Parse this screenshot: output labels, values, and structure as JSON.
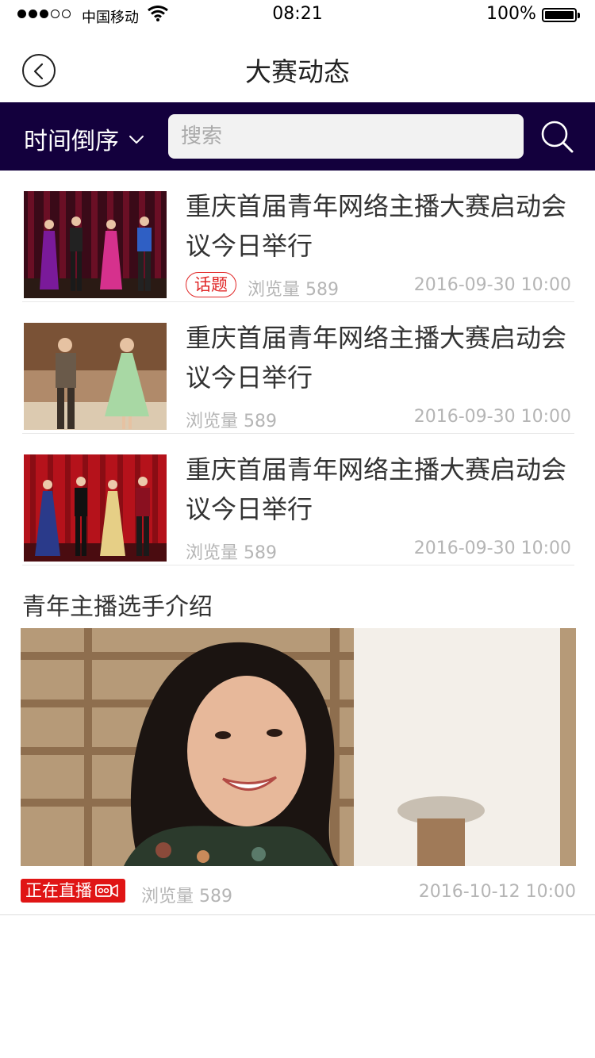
{
  "status_bar": {
    "carrier": "中国移动",
    "time": "08:21",
    "battery": "100%"
  },
  "nav": {
    "title": "大赛动态",
    "back_icon": "chevron-left-icon"
  },
  "filter": {
    "sort_label": "时间倒序",
    "sort_icon": "chevron-down-icon",
    "search_placeholder": "搜索",
    "search_value": "",
    "search_icon": "search-icon",
    "background": "#13003d"
  },
  "news": [
    {
      "title": "重庆首届青年网络主播大赛启动会议今日举行",
      "tag": "话题",
      "views": "浏览量 589",
      "date": "2016-09-30  10:00"
    },
    {
      "title": "重庆首届青年网络主播大赛启动会议今日举行",
      "tag": "",
      "views": "浏览量 589",
      "date": "2016-09-30  10:00"
    },
    {
      "title": "重庆首届青年网络主播大赛启动会议今日举行",
      "tag": "",
      "views": "浏览量 589",
      "date": "2016-09-30  10:00"
    }
  ],
  "section": {
    "title": "青年主播选手介绍",
    "live_label": "正在直播",
    "live_icon": "video-camera-icon",
    "views": "浏览量 589",
    "date": "2016-10-12  10:00"
  },
  "colors": {
    "accent_red": "#e02525",
    "live_red": "#e01515",
    "meta_gray": "#b5b5b5"
  }
}
